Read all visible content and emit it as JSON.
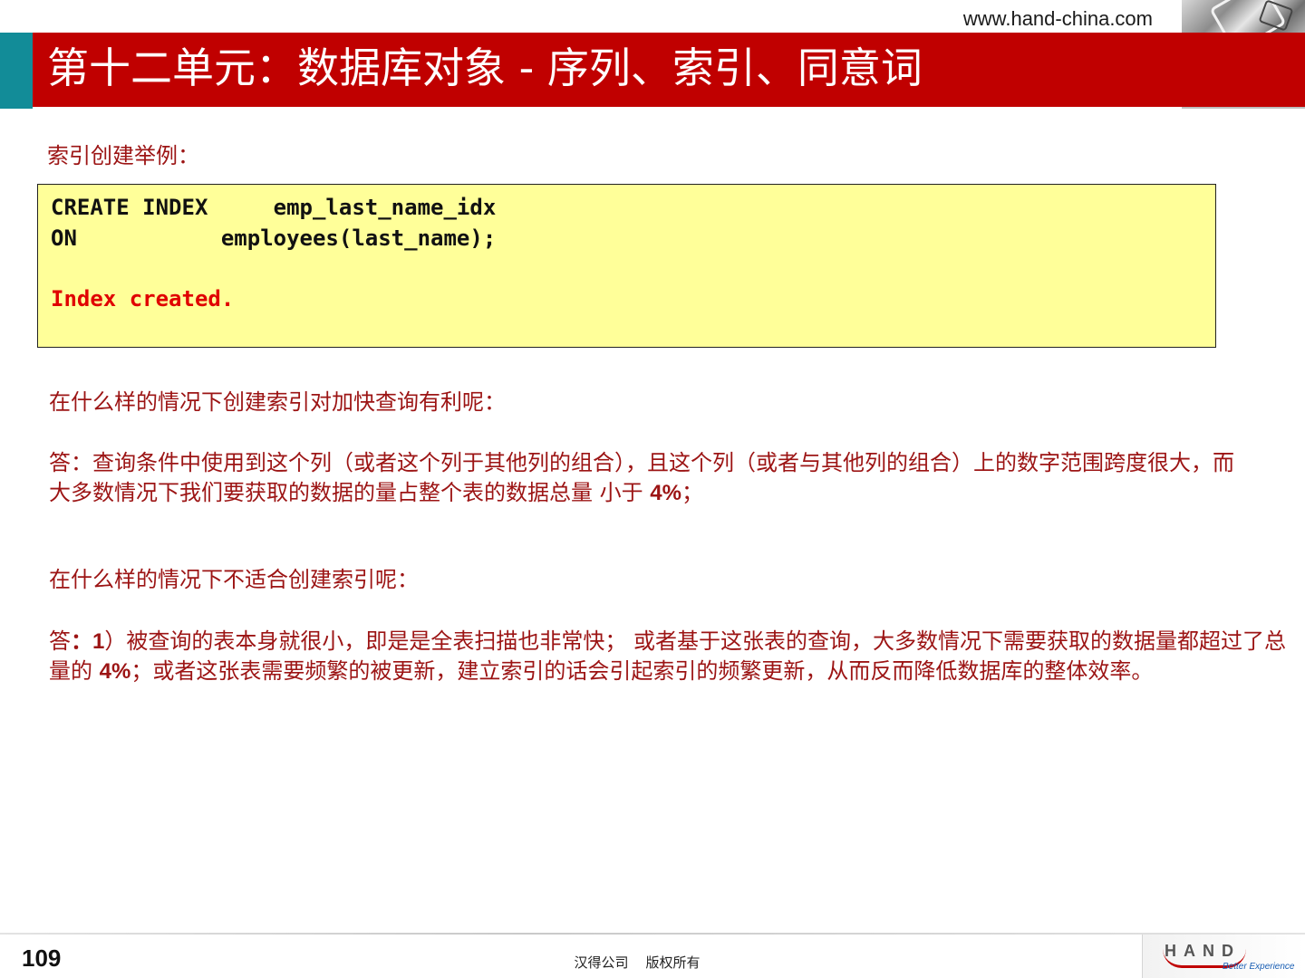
{
  "header": {
    "site_url": "www.hand-china.com",
    "title": "第十二单元：数据库对象 - 序列、索引、同意词"
  },
  "section": {
    "label": "索引创建举例："
  },
  "code": {
    "line1": "CREATE INDEX     emp_last_name_idx",
    "line2": "ON           employees(last_name);",
    "result": "Index created."
  },
  "content": {
    "q1": "在什么样的情况下创建索引对加快查询有利呢：",
    "a1_part1": "答：查询条件中使用到这个列（或者这个列于其他列的组合），且这个列（或者与其他列的组合）上的数字范围跨度很大，而大多数情况下我们要获取的数据的量占整个表的数据总量 小于 ",
    "a1_pct": "4%",
    "a1_end": "；",
    "q2": "在什么样的情况下不适合创建索引呢：",
    "a2_prefix": "答",
    "a2_num": "：1",
    "a2_part1": "）被查询的表本身就很小，即是是全表扫描也非常快；  或者基于这张表的查询，大多数情况下需要获取的数据量都超过了总量的 ",
    "a2_pct": "4%",
    "a2_part2": "；或者这张表需要频繁的被更新，建立索引的话会引起索引的频繁更新，从而反而降低数据库的整体效率。"
  },
  "footer": {
    "page_number": "109",
    "copyright": "汉得公司    版权所有",
    "logo_text": "HAND",
    "logo_tagline": "Better Experience"
  },
  "colors": {
    "title_bar": "#c00000",
    "title_accent": "#128c98",
    "body_text": "#9c1414",
    "code_bg": "#ffff99",
    "code_result": "#e00000"
  }
}
